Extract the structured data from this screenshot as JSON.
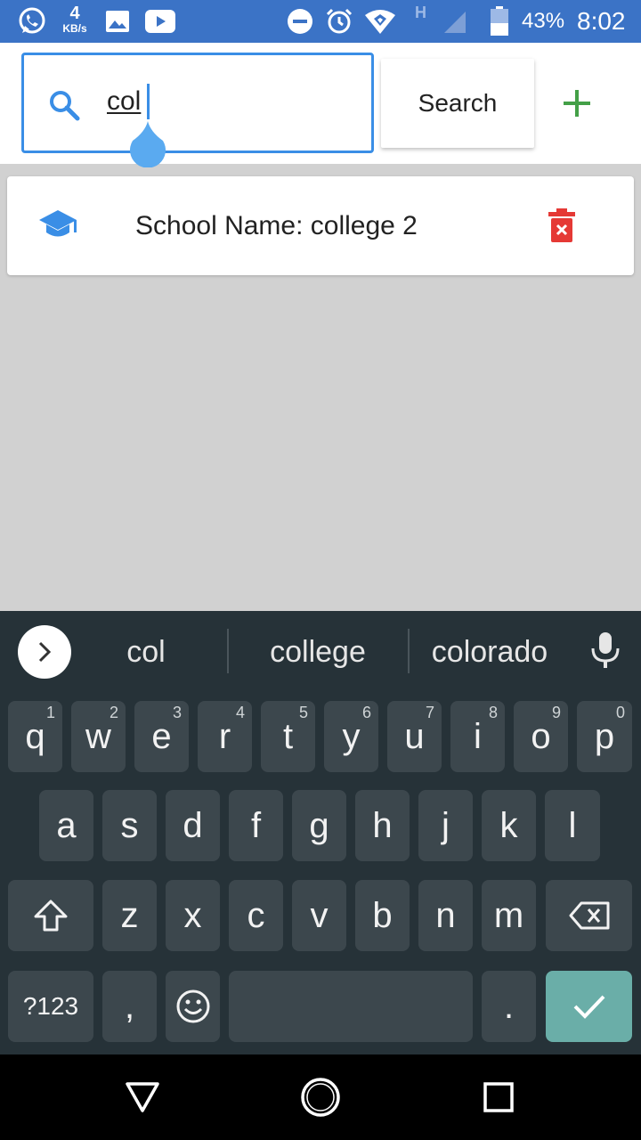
{
  "status_bar": {
    "net_speed_value": "4",
    "net_speed_unit": "KB/s",
    "network_type": "H",
    "battery_percent": "43%",
    "time": "8:02",
    "icons": [
      "whatsapp-icon",
      "gallery-icon",
      "youtube-icon",
      "dnd-icon",
      "alarm-icon",
      "wifi-icon",
      "signal-icon",
      "battery-icon"
    ]
  },
  "search": {
    "query": "col",
    "button_label": "Search",
    "add_icon": "plus-icon"
  },
  "results": [
    {
      "label": "School Name: college 2",
      "icon": "graduation-cap-icon",
      "action_icon": "trash-icon"
    }
  ],
  "colors": {
    "status_bar": "#3b73c6",
    "accent": "#3a8ee6",
    "add": "#43a047",
    "delete": "#e53935",
    "keyboard_bg": "#263238",
    "key_bg": "#3c474d",
    "enter_key": "#6aaea8"
  },
  "keyboard": {
    "suggestions": [
      "col",
      "college",
      "colorado"
    ],
    "row1": [
      {
        "k": "q",
        "h": "1"
      },
      {
        "k": "w",
        "h": "2"
      },
      {
        "k": "e",
        "h": "3"
      },
      {
        "k": "r",
        "h": "4"
      },
      {
        "k": "t",
        "h": "5"
      },
      {
        "k": "y",
        "h": "6"
      },
      {
        "k": "u",
        "h": "7"
      },
      {
        "k": "i",
        "h": "8"
      },
      {
        "k": "o",
        "h": "9"
      },
      {
        "k": "p",
        "h": "0"
      }
    ],
    "row2": [
      "a",
      "s",
      "d",
      "f",
      "g",
      "h",
      "j",
      "k",
      "l"
    ],
    "row3": [
      "z",
      "x",
      "c",
      "v",
      "b",
      "n",
      "m"
    ],
    "symbols_label": "?123",
    "comma": ",",
    "period": "."
  },
  "nav_bar": {
    "icons": [
      "back-icon",
      "home-icon",
      "recents-icon"
    ]
  }
}
